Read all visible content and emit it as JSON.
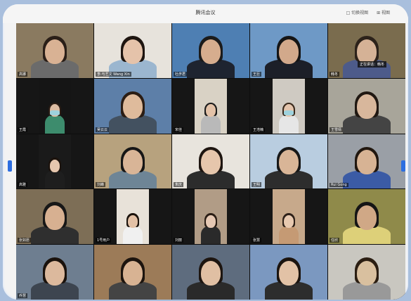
{
  "window": {
    "title": "腾讯会议",
    "controls": [
      "□ 切换视图",
      "⊞ 视图"
    ]
  },
  "speaker_tag": "正在讲话：韩冬",
  "colors": {
    "page_bg": "#a9bfdd",
    "frame": "#f3f3f3",
    "stage": "#0d0d0d",
    "nav_accent": "#2d6ee0"
  },
  "tiles": [
    {
      "label": "高娜",
      "bg": "#8a7a60",
      "skin": "#d9b294",
      "hair": "#2a1f18",
      "cloth": "#6b6b6b"
    },
    {
      "label": "李·与艺文  Wang Xin",
      "bg": "#e7e3dc",
      "skin": "#e5c3aa",
      "hair": "#1e1510",
      "cloth": "#9bb6cf"
    },
    {
      "label": "杜彦君",
      "bg": "#4e7fb3",
      "skin": "#d6ad8e",
      "hair": "#1b1b1b",
      "cloth": "#1e2430"
    },
    {
      "label": "王巨",
      "bg": "#6e99c6",
      "skin": "#d2a98b",
      "hair": "#151515",
      "cloth": "#1c1f28"
    },
    {
      "label": "韩冬",
      "bg": "#7a6c4e",
      "skin": "#d5b296",
      "hair": "#2c221a",
      "cloth": "#4d5b8a"
    },
    {
      "label": "王霞",
      "bg": "#151515",
      "skin": "#dcbca2",
      "hair": "#2a1c14",
      "cloth": "#3d8c6d"
    },
    {
      "label": "吴云云",
      "bg": "#5d7fa8",
      "skin": "#dfbb9c",
      "hair": "#2b1d14",
      "cloth": "#435160"
    },
    {
      "label": "宋佳",
      "bg": "#d9d2c5",
      "skin": "#e3c2a8",
      "hair": "#1c1c1c",
      "cloth": "#b9b9b9"
    },
    {
      "label": "王浩楠",
      "bg": "#cfcac2",
      "skin": "#e4c5ad",
      "hair": "#3a2a1c",
      "cloth": "#e6e6e6"
    },
    {
      "label": "王雪倩",
      "bg": "#a8a59a",
      "skin": "#d8b79c",
      "hair": "#201812",
      "cloth": "#444"
    },
    {
      "label": "高雅",
      "bg": "#1a1a1a",
      "skin": "#e6c7ae",
      "hair": "#1b120c",
      "cloth": "#1e1e1e"
    },
    {
      "label": "刘峰",
      "bg": "#b7a27e",
      "skin": "#d9b597",
      "hair": "#161616",
      "cloth": "#6e8596"
    },
    {
      "label": "朱庆",
      "bg": "#e8e4dd",
      "skin": "#e6c6ac",
      "hair": "#1e1510",
      "cloth": "#2c2c2c"
    },
    {
      "label": "王明",
      "bg": "#b9cde0",
      "skin": "#d9b597",
      "hair": "#181818",
      "cloth": "#2d2d2d"
    },
    {
      "label": "Rui Gong",
      "bg": "#9a9fa6",
      "skin": "#d7b394",
      "hair": "#21170f",
      "cloth": "#3b5ba5"
    },
    {
      "label": "张如愿",
      "bg": "#7d6e56",
      "skin": "#d7b091",
      "hair": "#171717",
      "cloth": "#2f2f2f"
    },
    {
      "label": "1号用户",
      "bg": "#e8e2d9",
      "skin": "#e3c1a6",
      "hair": "#1b130d",
      "cloth": "#f0f0f0"
    },
    {
      "label": "刘丽",
      "bg": "#b19c86",
      "skin": "#e5c8b3",
      "hair": "#2a1d14",
      "cloth": "#2a2a2a"
    },
    {
      "label": "张慧",
      "bg": "#c7a98b",
      "skin": "#e7c9b0",
      "hair": "#2d2018",
      "cloth": "#c59a74"
    },
    {
      "label": "任欣",
      "bg": "#8f8a4a",
      "skin": "#d0a886",
      "hair": "#151515",
      "cloth": "#ddd079"
    },
    {
      "label": "乔慧",
      "bg": "#6e7e90",
      "skin": "#dcb99d",
      "hair": "#1a120c",
      "cloth": "#3d4550"
    },
    {
      "label": "",
      "bg": "#9c7b58",
      "skin": "#d8b393",
      "hair": "#1c140e",
      "cloth": "#444"
    },
    {
      "label": "",
      "bg": "#5e6c7e",
      "skin": "#e0bfa3",
      "hair": "#1d1510",
      "cloth": "#2a2a2a"
    },
    {
      "label": "",
      "bg": "#7b98c0",
      "skin": "#e2c2a6",
      "hair": "#1b140f",
      "cloth": "#2d2d2d"
    },
    {
      "label": "",
      "bg": "#c9c7c0",
      "skin": "#d9c09f",
      "hair": "#2b1e12",
      "cloth": "#999"
    }
  ]
}
